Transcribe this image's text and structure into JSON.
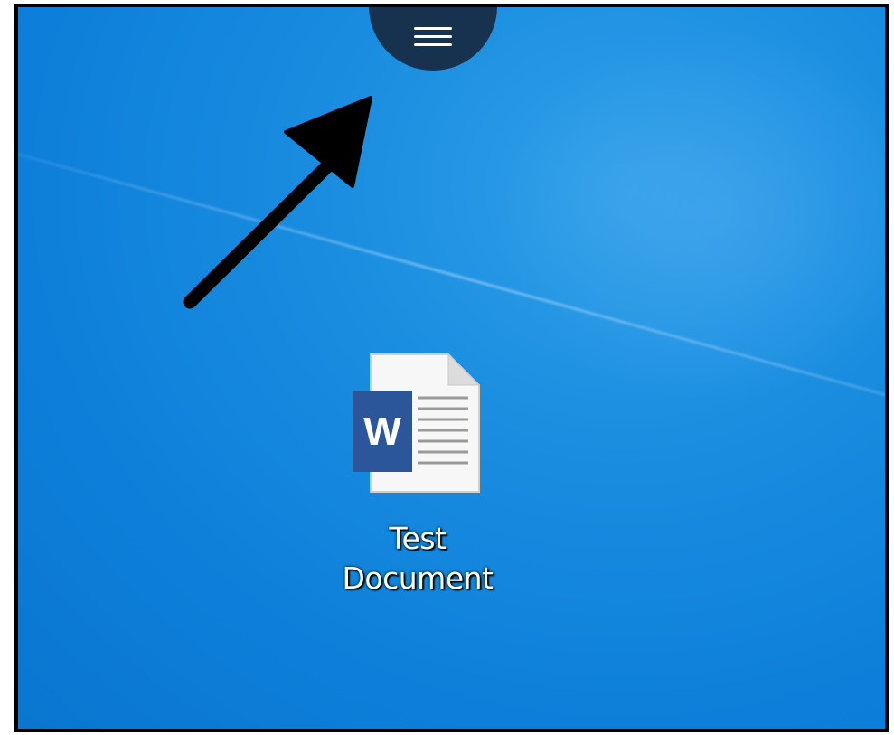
{
  "desktop": {
    "background_color": "#0d7fda",
    "icons": [
      {
        "label_line1": "Test",
        "label_line2": "Document",
        "icon": "word-document-icon",
        "app_letter": "W"
      }
    ]
  },
  "menu_button": {
    "icon": "hamburger-menu-icon",
    "color": "#16324f"
  },
  "annotation": {
    "icon": "arrow-pointer-icon",
    "color": "#000000"
  }
}
